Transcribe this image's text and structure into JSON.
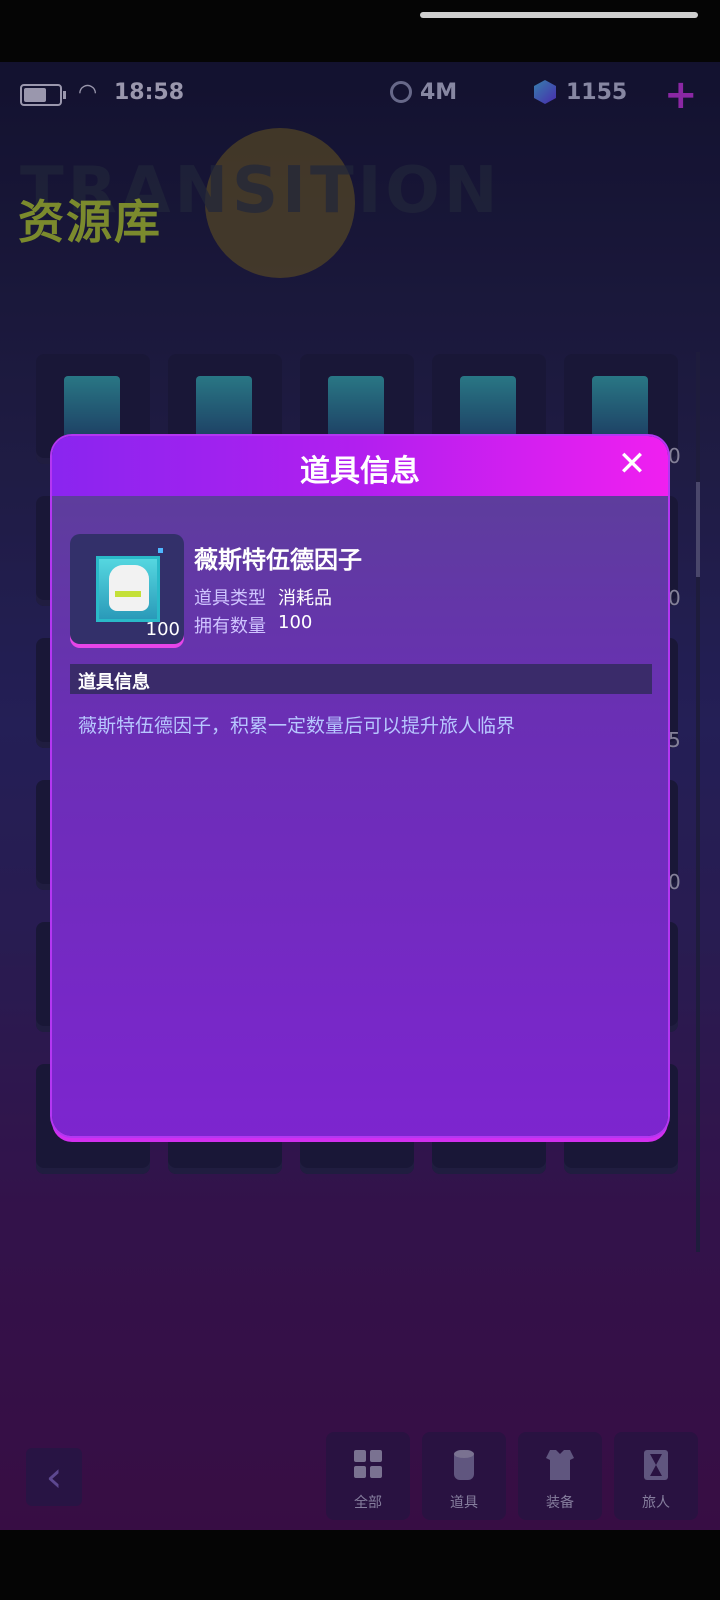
{
  "status": {
    "time": "18:58",
    "resource1": "4M",
    "resource2": "1155"
  },
  "header": {
    "page_title": "资源库",
    "banner_text": "TRANSITION"
  },
  "grid": {
    "side_numbers": [
      "0",
      "0",
      "5",
      "0"
    ]
  },
  "bottom_nav": {
    "tabs": [
      {
        "label": "全部"
      },
      {
        "label": "道具"
      },
      {
        "label": "装备"
      },
      {
        "label": "旅人"
      }
    ]
  },
  "dialog": {
    "title": "道具信息",
    "item_name": "薇斯特伍德因子",
    "item_count": "100",
    "type_label": "道具类型",
    "type_value": "消耗品",
    "owned_label": "拥有数量",
    "owned_value": "100",
    "section_title": "道具信息",
    "description": "薇斯特伍德因子，积累一定数量后可以提升旅人临界"
  },
  "colors": {
    "accent": "#d23cf2",
    "title_green": "#b9d43b",
    "dialog_header_start": "#8a25ef",
    "dialog_header_end": "#f01ff0"
  }
}
